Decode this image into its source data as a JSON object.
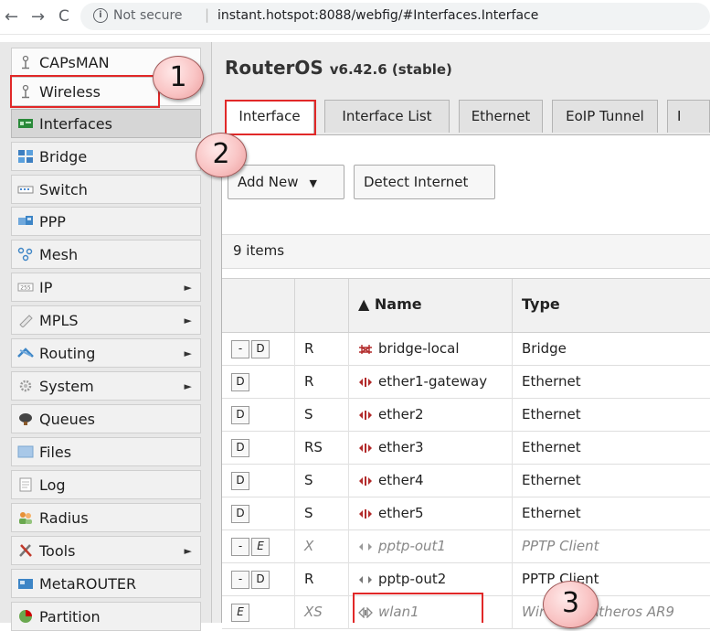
{
  "browser": {
    "back": "←",
    "forward": "→",
    "reload": "C",
    "info": "i",
    "security": "Not secure",
    "separator": "|",
    "url": "instant.hotspot:8088/webfig/#Interfaces.Interface"
  },
  "sidebar": {
    "items": [
      {
        "label": "CAPsMAN",
        "icon": "antenna-icon",
        "arrow": ""
      },
      {
        "label": "Wireless",
        "icon": "antenna-icon",
        "arrow": ""
      },
      {
        "label": "Interfaces",
        "icon": "interfaces-icon",
        "arrow": ""
      },
      {
        "label": "Bridge",
        "icon": "bridge-icon",
        "arrow": ""
      },
      {
        "label": "Switch",
        "icon": "switch-icon",
        "arrow": ""
      },
      {
        "label": "PPP",
        "icon": "ppp-icon",
        "arrow": ""
      },
      {
        "label": "Mesh",
        "icon": "mesh-icon",
        "arrow": ""
      },
      {
        "label": "IP",
        "icon": "ip-icon",
        "arrow": "►"
      },
      {
        "label": "MPLS",
        "icon": "mpls-icon",
        "arrow": "►"
      },
      {
        "label": "Routing",
        "icon": "routing-icon",
        "arrow": "►"
      },
      {
        "label": "System",
        "icon": "gear-icon",
        "arrow": "►"
      },
      {
        "label": "Queues",
        "icon": "queues-icon",
        "arrow": ""
      },
      {
        "label": "Files",
        "icon": "folder-icon",
        "arrow": ""
      },
      {
        "label": "Log",
        "icon": "log-icon",
        "arrow": ""
      },
      {
        "label": "Radius",
        "icon": "users-icon",
        "arrow": ""
      },
      {
        "label": "Tools",
        "icon": "tools-icon",
        "arrow": "►"
      },
      {
        "label": "MetaROUTER",
        "icon": "metarouter-icon",
        "arrow": ""
      },
      {
        "label": "Partition",
        "icon": "partition-icon",
        "arrow": ""
      }
    ]
  },
  "main": {
    "title": "RouterOS",
    "version": "v6.42.6 (stable)",
    "tabs": [
      "Interface",
      "Interface List",
      "Ethernet",
      "EoIP Tunnel",
      "I"
    ],
    "add_new": "Add New",
    "add_new_caret": "▼",
    "detect_internet": "Detect Internet",
    "item_count": "9 items",
    "columns": [
      "",
      "",
      "▲ Name",
      "Type"
    ],
    "rows": [
      {
        "ctrl": [
          "-",
          "D"
        ],
        "flags": "R",
        "name": "bridge-local",
        "type": "Bridge",
        "icon": "bridge-icon",
        "disabled": false
      },
      {
        "ctrl": [
          "D"
        ],
        "flags": "R",
        "name": "ether1-gateway",
        "type": "Ethernet",
        "icon": "ethernet-icon",
        "disabled": false
      },
      {
        "ctrl": [
          "D"
        ],
        "flags": "S",
        "name": "ether2",
        "type": "Ethernet",
        "icon": "ethernet-icon",
        "disabled": false
      },
      {
        "ctrl": [
          "D"
        ],
        "flags": "RS",
        "name": "ether3",
        "type": "Ethernet",
        "icon": "ethernet-icon",
        "disabled": false
      },
      {
        "ctrl": [
          "D"
        ],
        "flags": "S",
        "name": "ether4",
        "type": "Ethernet",
        "icon": "ethernet-icon",
        "disabled": false
      },
      {
        "ctrl": [
          "D"
        ],
        "flags": "S",
        "name": "ether5",
        "type": "Ethernet",
        "icon": "ethernet-icon",
        "disabled": false
      },
      {
        "ctrl": [
          "-",
          "E"
        ],
        "flags": "X",
        "name": "pptp-out1",
        "type": "PPTP Client",
        "icon": "ppp-icon",
        "disabled": true
      },
      {
        "ctrl": [
          "-",
          "D"
        ],
        "flags": "R",
        "name": "pptp-out2",
        "type": "PPTP Client",
        "icon": "ppp-icon",
        "disabled": false
      },
      {
        "ctrl": [
          "E"
        ],
        "flags": "XS",
        "name": "wlan1",
        "type": "Wireless (Atheros AR9",
        "icon": "wireless-icon",
        "disabled": true
      }
    ]
  },
  "callouts": [
    "1",
    "2",
    "3"
  ],
  "colors": {
    "highlight": "#e12828",
    "callout": "#f9c4c4",
    "ethernet_icon": "#b22a2a"
  }
}
